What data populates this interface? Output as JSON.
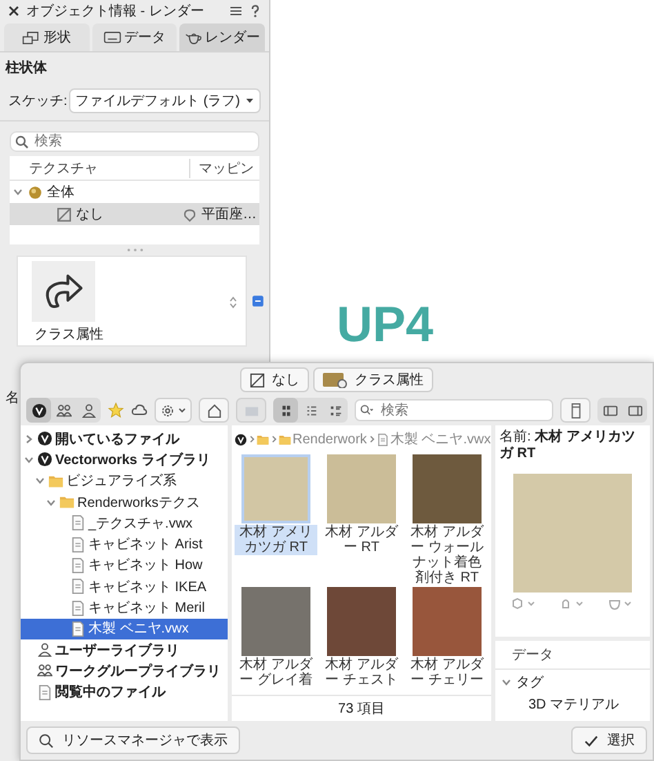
{
  "object_info": {
    "title": "オブジェクト情報 - レンダー",
    "tabs": [
      {
        "label": "形状",
        "kind": "shape",
        "selected": false
      },
      {
        "label": "データ",
        "kind": "data",
        "selected": false
      },
      {
        "label": "レンダー",
        "kind": "render",
        "selected": true
      }
    ],
    "object_type": "柱状体",
    "sketch_label": "スケッチ:",
    "sketch_value": "ファイルデフォルト (ラフ)",
    "search_placeholder": "検索",
    "columns": [
      "テクスチャ",
      "マッピン"
    ],
    "tree": [
      {
        "label": "全体",
        "expanded": true,
        "children": [
          {
            "label": "なし",
            "mapping": "平面座…",
            "selected": true
          }
        ]
      }
    ],
    "class_card_label": "クラス属性",
    "cut_label": "名"
  },
  "overlay_text": "UP4",
  "resource_popup": {
    "top_buttons": [
      {
        "label": "なし",
        "kind": "none"
      },
      {
        "label": "クラス属性",
        "kind": "class"
      }
    ],
    "sources": [
      {
        "kind": "vw",
        "selected": true
      },
      {
        "kind": "group",
        "selected": false
      },
      {
        "kind": "user",
        "selected": false
      }
    ],
    "views": [
      {
        "kind": "grid",
        "selected": true
      },
      {
        "kind": "list",
        "selected": false
      },
      {
        "kind": "details",
        "selected": false
      }
    ],
    "search_placeholder": "検索",
    "sidebar": [
      {
        "label": "開いているファイル",
        "kind": "vw",
        "expanded": false,
        "selected": false
      },
      {
        "label": "Vectorworks ライブラリ",
        "kind": "vw",
        "expanded": true,
        "selected": false,
        "children": [
          {
            "label": "ビジュアライズ系",
            "kind": "folder",
            "expanded": true,
            "selected": false,
            "children": [
              {
                "label": "Renderworksテクス",
                "kind": "folder",
                "expanded": true,
                "selected": false,
                "children": [
                  {
                    "label": "_テクスチャ.vwx",
                    "kind": "file",
                    "selected": false
                  },
                  {
                    "label": "キャビネット Arist",
                    "kind": "file",
                    "selected": false
                  },
                  {
                    "label": "キャビネット How",
                    "kind": "file",
                    "selected": false
                  },
                  {
                    "label": "キャビネット IKEA",
                    "kind": "file",
                    "selected": false
                  },
                  {
                    "label": "キャビネット Meril",
                    "kind": "file",
                    "selected": false
                  },
                  {
                    "label": "木製 ベニヤ.vwx",
                    "kind": "file",
                    "selected": true
                  }
                ]
              }
            ]
          }
        ]
      },
      {
        "label": "ユーザーライブラリ",
        "kind": "user",
        "selected": false
      },
      {
        "label": "ワークグループライブラリ",
        "kind": "group",
        "selected": false
      },
      {
        "label": "閲覧中のファイル",
        "kind": "file",
        "selected": false
      }
    ],
    "breadcrumb": [
      "Renderwork",
      "木製 ベニヤ.vwx"
    ],
    "items": [
      {
        "name": "木材 アメリカツガ RT",
        "color": "#d2c6a4",
        "selected": true
      },
      {
        "name": "木材 アルダー RT",
        "color": "#cbbd98",
        "selected": false
      },
      {
        "name": "木材 アルダー ウォールナット着色剤付き RT",
        "color": "#6e5a3e",
        "selected": false
      },
      {
        "name": "木材 アルダー グレイ着",
        "color": "#76726c",
        "selected": false
      },
      {
        "name": "木材 アルダー チェスト",
        "color": "#6e4838",
        "selected": false
      },
      {
        "name": "木材 アルダー チェリー",
        "color": "#98563c",
        "selected": false
      }
    ],
    "count": "73 項目",
    "name_label": "名前:",
    "name_value": "木材 アメリカツガ RT",
    "data_tab": "データ",
    "tags": {
      "label": "タグ",
      "expanded": true,
      "children": [
        "3D マテリアル"
      ]
    },
    "show_button": "リソースマネージャで表示",
    "select_button": "選択"
  }
}
